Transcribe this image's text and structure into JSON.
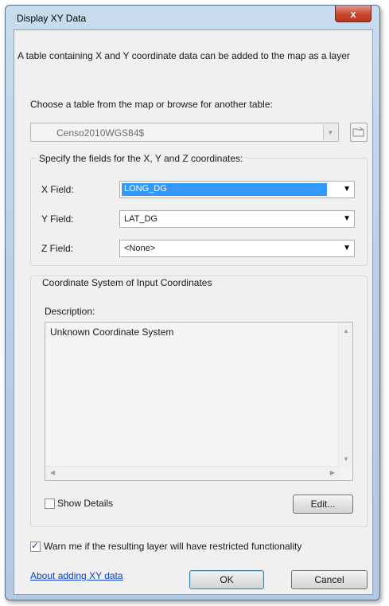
{
  "window": {
    "title": "Display XY Data",
    "close_glyph": "x"
  },
  "intro_text": "A table containing X and Y coordinate data can be added to the map as a layer",
  "table_section": {
    "label": "Choose a table from the map or browse for another table:",
    "selected_table": "Censo2010WGS84$"
  },
  "fields_group": {
    "title": "Specify the fields for the X, Y and Z coordinates:",
    "x_label": "X Field:",
    "x_value": "LONG_DG",
    "y_label": "Y Field:",
    "y_value": "LAT_DG",
    "z_label": "Z Field:",
    "z_value": "<None>"
  },
  "coords_group": {
    "title": "Coordinate System of Input Coordinates",
    "description_label": "Description:",
    "description_text": "Unknown Coordinate System",
    "show_details_label": "Show Details",
    "show_details_checked": false,
    "edit_label": "Edit..."
  },
  "warn": {
    "label": "Warn me if the resulting layer will have restricted functionality",
    "checked": true
  },
  "footer": {
    "about_link": "About adding XY data",
    "ok_label": "OK",
    "cancel_label": "Cancel"
  },
  "icons": {
    "close": "close-icon",
    "dropdown": "chevron-down-icon",
    "browse": "open-folder-icon"
  },
  "colors": {
    "selection": "#3399ff",
    "close_button": "#c9442c",
    "link": "#0b3fd6"
  }
}
